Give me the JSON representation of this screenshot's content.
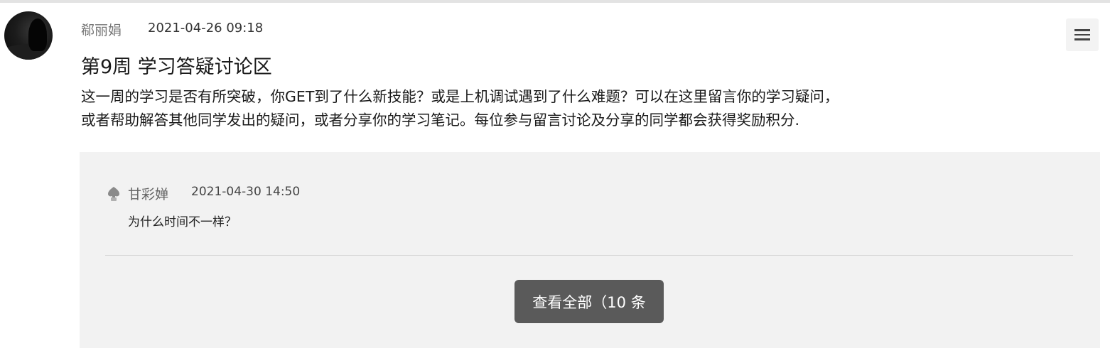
{
  "post": {
    "author": "郗丽娟",
    "time": "2021-04-26 09:18",
    "title": "第9周 学习答疑讨论区",
    "body_lines": [
      "这一周的学习是否有所突破，你GET到了什么新技能？或是上机调试遇到了什么难题？可以在这里留言你的学习疑问，",
      "或者帮助解答其他同学发出的疑问，或者分享你的学习笔记。每位参与留言讨论及分享的同学都会获得奖励积分."
    ],
    "menu_icon": "hamburger-menu-icon"
  },
  "reply": {
    "icon": "thumbs-up-icon",
    "author": "甘彩婵",
    "time": "2021-04-30 14:50",
    "text": "为什么时间不一样？"
  },
  "view_all_label": "查看全部（10 条",
  "colors": {
    "panel_bg": "#f2f2f2",
    "button_bg": "#5a5a5a",
    "button_text": "#ffffff"
  }
}
